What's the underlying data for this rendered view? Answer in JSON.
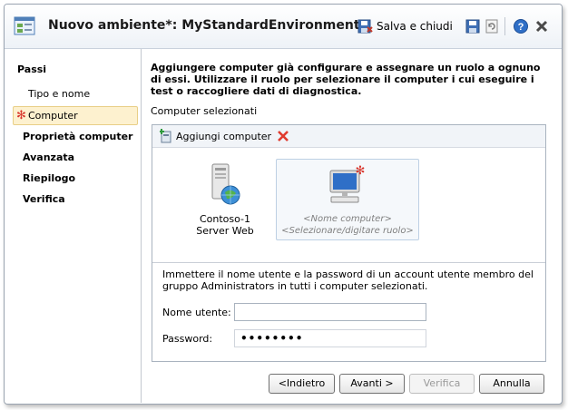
{
  "window": {
    "title": "Nuovo ambiente*: MyStandardEnvironment",
    "save_close_label": "Salva e chiudi"
  },
  "sidebar": {
    "heading": "Passi",
    "items": [
      {
        "label": "Tipo e nome",
        "bold": false,
        "selected": false
      },
      {
        "label": "Computer",
        "bold": false,
        "selected": true
      },
      {
        "label": "Proprietà computer",
        "bold": true,
        "selected": false
      },
      {
        "label": "Avanzata",
        "bold": true,
        "selected": false
      },
      {
        "label": "Riepilogo",
        "bold": true,
        "selected": false
      },
      {
        "label": "Verifica",
        "bold": true,
        "selected": false
      }
    ]
  },
  "main": {
    "instructions": "Aggiungere computer già configurare e assegnare un ruolo a ognuno di essi. Utilizzare il ruolo per selezionare il computer i cui eseguire i test o raccogliere dati di diagnostica.",
    "selected_label": "Computer selezionati",
    "add_computer_label": "Aggiungi computer",
    "computers": [
      {
        "name": "Contoso-1",
        "role": "Server Web"
      },
      {
        "name": "<Nome computer>",
        "role": "<Selezionare/digitare ruolo>"
      }
    ],
    "credentials_note": "Immettere il nome utente e la password di un account utente membro del gruppo Administrators in tutti i computer selezionati.",
    "username_label": "Nome utente:",
    "username_value": "",
    "password_label": "Password:",
    "password_value": "••••••••"
  },
  "buttons": {
    "back": "<Indietro",
    "next": "Avanti >",
    "verify": "Verifica",
    "cancel": "Annulla"
  },
  "colors": {
    "accent_star": "#d8342b",
    "selected_bg": "#fdf1cf"
  }
}
